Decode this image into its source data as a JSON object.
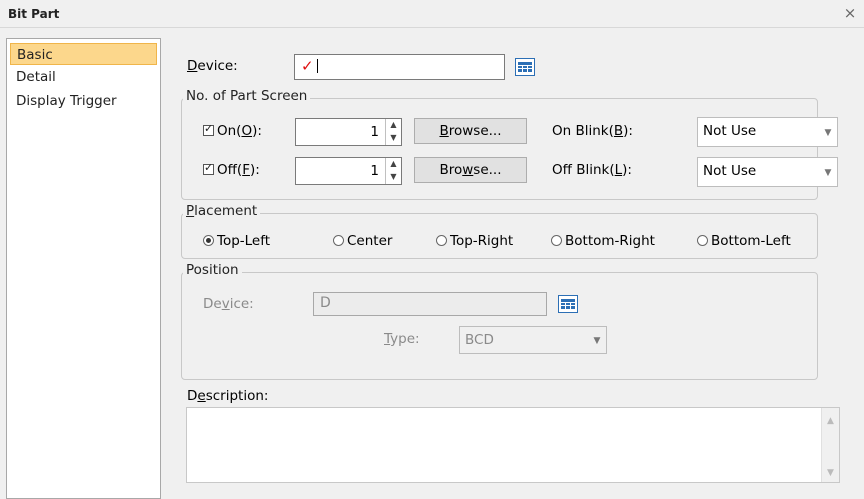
{
  "window": {
    "title": "Bit Part",
    "close_glyph": "×"
  },
  "sidebar": {
    "items": [
      {
        "label": "Basic",
        "selected": true
      },
      {
        "label": "Detail",
        "selected": false
      },
      {
        "label": "Display Trigger",
        "selected": false
      }
    ]
  },
  "basic": {
    "device": {
      "label_u": "D",
      "label_rest": "evice:",
      "value": ""
    },
    "part_screen": {
      "legend": "No. of Part Screen",
      "on": {
        "label_pre": "On(",
        "label_u": "O",
        "label_post": "):",
        "checked": true,
        "value": "1",
        "browse_pre": "",
        "browse_u": "B",
        "browse_post": "rowse...",
        "blink_pre": "On Blink(",
        "blink_u": "B",
        "blink_post": "):",
        "blink_value": "Not Use"
      },
      "off": {
        "label_pre": "Off(",
        "label_u": "F",
        "label_post": "):",
        "checked": true,
        "value": "1",
        "browse_pre": "Bro",
        "browse_u": "w",
        "browse_post": "se...",
        "blink_pre": "Off Blink(",
        "blink_u": "L",
        "blink_post": "):",
        "blink_value": "Not Use"
      }
    },
    "placement": {
      "legend_u": "P",
      "legend_rest": "lacement",
      "options": [
        "Top-Left",
        "Center",
        "Top-Right",
        "Bottom-Right",
        "Bottom-Left"
      ],
      "selected": "Top-Left"
    },
    "position": {
      "legend": "Position",
      "device_pre": "De",
      "device_u": "v",
      "device_post": "ice:",
      "device_value": "D",
      "type_u": "T",
      "type_rest": "ype:",
      "type_value": "BCD"
    },
    "description": {
      "label_pre": "D",
      "label_u": "e",
      "label_post": "scription:",
      "value": ""
    }
  },
  "icons": {
    "device_picker": "device-grid-icon",
    "dropdown": "chevron-down-icon",
    "spin": "spin-arrows-icon"
  },
  "colors": {
    "selected_bg": "#fcd78c",
    "accent": "#2c6fb5",
    "check": "#e01010"
  }
}
